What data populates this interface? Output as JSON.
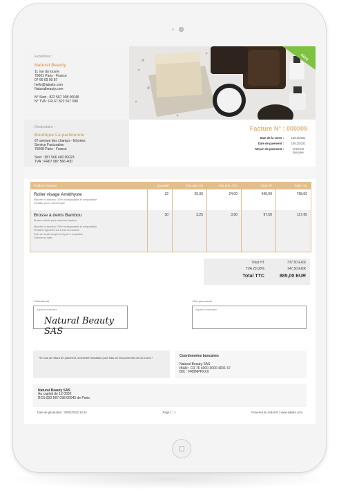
{
  "sender": {
    "label": "Expéditeur :",
    "name": "Natural Beauty",
    "lines": [
      "11 rue du louvre",
      "75001 Paris - France",
      "07 66 69 90 87",
      "hello@iabako.com",
      "Naturalbeauty.com"
    ],
    "ids": [
      "N° Siret : 822 567 098 00045",
      "N° TVA : FR 67 822 567 098"
    ]
  },
  "client": {
    "label": "Destinataire :",
    "name": "Boutique La parisienne",
    "lines": [
      "67 avenue des champs - Elysées",
      "Service Facturation",
      "75008 Paris - France"
    ],
    "ids": [
      "Siret : 987 566 400 00023",
      "TVA : FR67 987 566 400"
    ]
  },
  "badge": "PAYE",
  "invoice": {
    "title": "Facture N° : 000009",
    "meta": [
      {
        "label": "Date de la vente :",
        "value": "16/12/2021"
      },
      {
        "label": "Date de paiement :",
        "value": "16/12/2021"
      },
      {
        "label": "Moyen de paiement :",
        "value": "Virement bancaire"
      }
    ]
  },
  "table": {
    "headers": [
      "Produit / Service",
      "Quantité",
      "Prix unit. HT",
      "Prix unit. TTC",
      "Total HT",
      "Total TTC"
    ],
    "rows": [
      {
        "name": "Roller visage Améthyste",
        "desc": [
          "Manche en bambou 100% biodégradable et compostable",
          "Véritable pierre d'Améthyste"
        ],
        "qty": "32",
        "pu_ht": "20,00",
        "pu_ttc": "24,00",
        "total_ht": "640,00",
        "total_ttc": "768,00"
      },
      {
        "name": "Brosse à dents Bambou",
        "desc": [
          "Brosse à dents pour enfant en bambou.",
          "",
          "Manche en bambou 100% biodégradable et compostable",
          "Pentaire régénérée sur le bas du manche",
          "Poils de durété souple en Nylon 6 recyclable",
          "Gravure au laser"
        ],
        "qty": "30",
        "pu_ht": "3,25",
        "pu_ttc": "3,90",
        "total_ht": "97,50",
        "total_ttc": "117,00"
      }
    ]
  },
  "totals": {
    "ht_label": "Total HT",
    "ht_value": "737,50 EUR",
    "tva_label": "TVA 20,00%",
    "tva_value": "147,50 EUR",
    "ttc_label": "Total TTC",
    "ttc_value": "885,00 EUR"
  },
  "signatures": {
    "left_label": "* Cachet/emet",
    "left_placeholder": "Signature expéditeur",
    "left_signature": "Natural Beauty SAS",
    "right_label": "* Bon pour accord",
    "right_placeholder": "Signature destinataire"
  },
  "penalty_note": "*En cas de retard de paiement, indemnité forfaitaire pour frais de recouvrement de 40 euros *",
  "bank": {
    "title": "Coordonnées bancaires",
    "lines": [
      "Natural Beauty SAS",
      "IBAN : FR 76 4000 3000 4001 67",
      "BIC : FRBNPPXXX"
    ]
  },
  "company": {
    "name": "Natural Beauty SAS",
    "lines": [
      "Au capital de 12 000€",
      "RCS 822 567 098 00045 de Paris."
    ]
  },
  "footer": {
    "left": "Date de génération : 06/02/2022 15:34",
    "center": "Page 1 / 1",
    "right": "Powered by IABAKO | www.iabako.com"
  },
  "colors": {
    "accent": "#e3bd8a",
    "title": "#e3b479",
    "badge": "#7fc241"
  }
}
